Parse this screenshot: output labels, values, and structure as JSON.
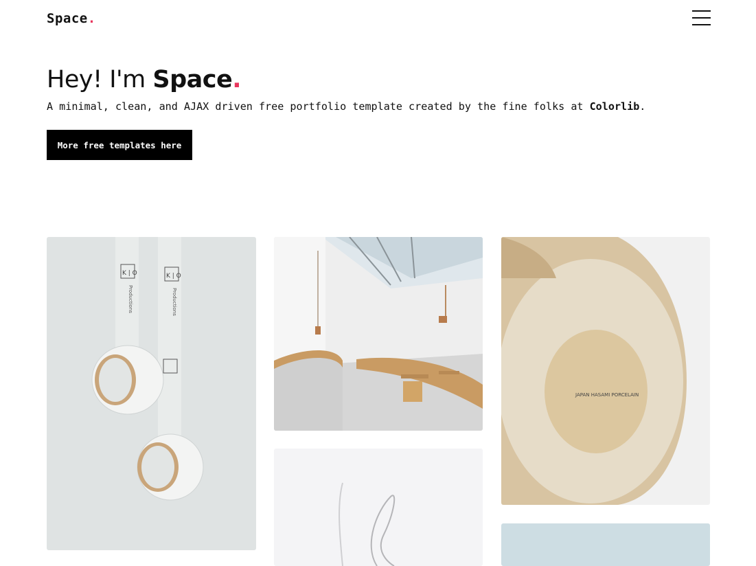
{
  "brand": {
    "name": "Space",
    "dot": "."
  },
  "nav": {
    "menu_icon": "hamburger-menu-icon"
  },
  "hero": {
    "greeting": "Hey! I'm ",
    "name": "Space",
    "dot": ".",
    "subtitle_prefix": "A minimal, clean, and AJAX driven free portfolio template created by the fine folks at ",
    "subtitle_brand": "Colorlib",
    "subtitle_suffix": ".",
    "cta_label": "More free templates here"
  },
  "colors": {
    "accent": "#e8365d",
    "button_bg": "#000000",
    "text": "#111111"
  },
  "portfolio": {
    "items": [
      {
        "image": "packing-tape-rolls-photo",
        "printed_text": [
          "K | O",
          "Productions"
        ]
      },
      {
        "image": "cafe-interior-photo"
      },
      {
        "image": "ceramic-cup-photo",
        "printed_text": [
          "JAPAN HASAMI PORCELAIN"
        ]
      },
      {
        "image": "wire-sculpture-photo"
      },
      {
        "image": "pale-blue-photo"
      }
    ]
  }
}
